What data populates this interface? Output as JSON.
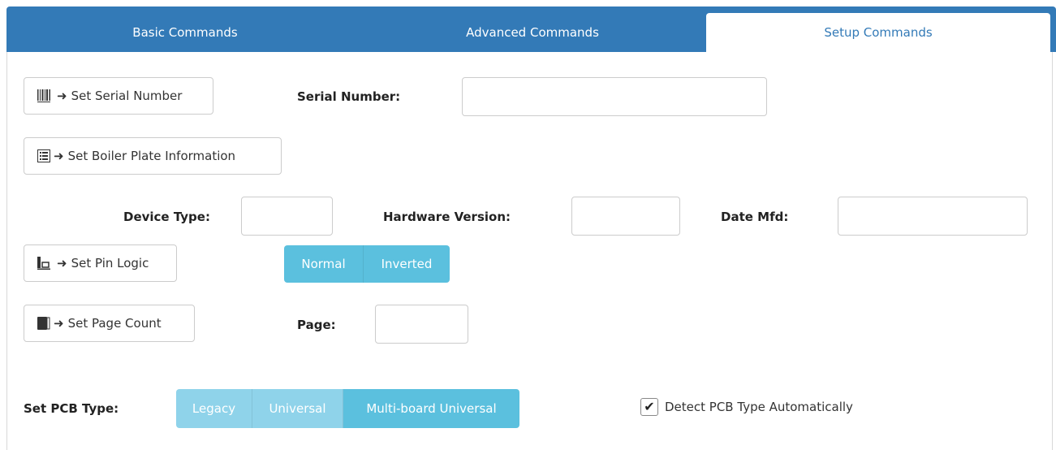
{
  "tabs": [
    {
      "label": "Basic Commands",
      "active": false
    },
    {
      "label": "Advanced Commands",
      "active": false
    },
    {
      "label": "Setup Commands",
      "active": true
    }
  ],
  "serial": {
    "button_label": "Set Serial Number",
    "icon": "barcode-icon",
    "field_label": "Serial Number:",
    "value": ""
  },
  "boiler": {
    "button_label": "Set Boiler Plate Information",
    "icon": "list-icon",
    "device_type_label": "Device Type:",
    "device_type_value": "",
    "hardware_version_label": "Hardware Version:",
    "hardware_version_value": "",
    "date_mfd_label": "Date Mfd:",
    "date_mfd_value": ""
  },
  "pin_logic": {
    "button_label": "Set Pin Logic",
    "icon": "pin-icon",
    "options": [
      "Normal",
      "Inverted"
    ]
  },
  "page_count": {
    "button_label": "Set Page Count",
    "icon": "book-icon",
    "field_label": "Page:",
    "value": ""
  },
  "pcb": {
    "label": "Set PCB Type:",
    "options": [
      "Legacy",
      "Universal",
      "Multi-board Universal"
    ],
    "detect_label": "Detect PCB Type Automatically",
    "detect_checked": true
  },
  "colors": {
    "tab_bar": "#337ab7",
    "segment_active": "#5bc0de",
    "segment_light": "#8fd3ea"
  }
}
